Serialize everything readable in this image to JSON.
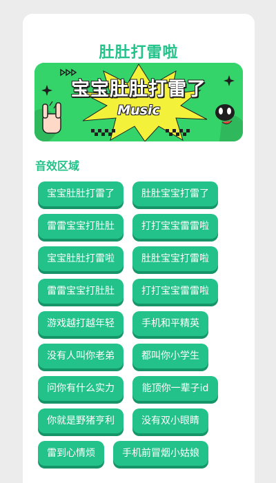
{
  "page_title": "肚肚打雷啦",
  "banner": {
    "title": "宝宝肚肚打雷了",
    "subtitle": "Music"
  },
  "section_title": "音效区域",
  "buttons": [
    "宝宝肚肚打雷了",
    "肚肚宝宝打雷了",
    "雷雷宝宝打肚肚",
    "打打宝宝雷雷啦",
    "宝宝肚肚打雷啦",
    "肚肚宝宝打雷啦",
    "雷雷宝宝打肚肚",
    "打打宝宝雷雷啦",
    "游戏越打越年轻",
    "手机和平精英",
    "没有人叫你老弟",
    "都叫你小学生",
    "问你有什么实力",
    "能顶你一辈子id",
    "你就是野猪亨利",
    "没有双小眼睛",
    "雷到心情烦",
    "手机前冒烟小姑娘"
  ],
  "colors": {
    "accent": "#22c28a",
    "banner_green": "#35d46a",
    "banner_burst": "#f4f13a"
  }
}
